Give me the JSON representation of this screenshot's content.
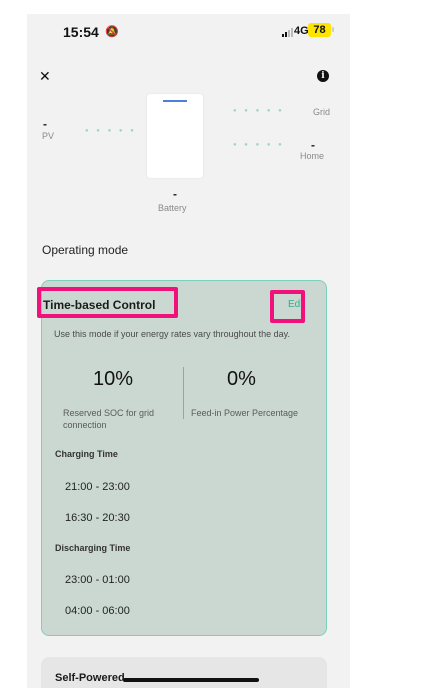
{
  "status_bar": {
    "time": "15:54",
    "network": "4G",
    "battery": "78",
    "battery_color": "#ffe400"
  },
  "header": {
    "close_icon": "close-icon",
    "info_icon": "info-icon"
  },
  "energy_flow": {
    "pv_value": "-",
    "pv_label": "PV",
    "grid_label": "Grid",
    "home_value": "-",
    "home_label": "Home",
    "battery_value": "-",
    "battery_label": "Battery"
  },
  "operating_mode": {
    "section_title": "Operating mode",
    "mode_name": "Time-based Control",
    "edit_label": "Edit",
    "description": "Use this mode if your energy rates vary throughout the day.",
    "reserved_soc_value": "10%",
    "reserved_soc_label": "Reserved SOC for grid connection",
    "feed_in_value": "0%",
    "feed_in_label": "Feed-in Power Percentage",
    "charging_title": "Charging Time",
    "charging_times": [
      "21:00 - 23:00",
      "16:30 - 20:30"
    ],
    "discharging_title": "Discharging Time",
    "discharging_times": [
      "23:00 - 01:00",
      "04:00 - 06:00"
    ]
  },
  "other_mode": {
    "title": "Self-Powered"
  },
  "colors": {
    "accent": "#2fae8e",
    "card_border": "#7ad0b8",
    "card_bg": "#cbd8d2",
    "highlight": "#f0127a"
  }
}
